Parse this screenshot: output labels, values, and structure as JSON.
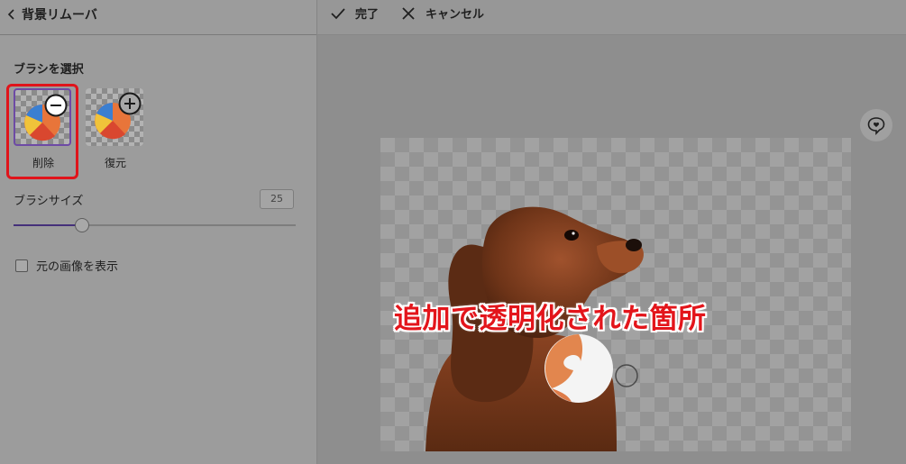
{
  "sidebar": {
    "title": "背景リムーバ",
    "brush_select_label": "ブラシを選択",
    "brushes": [
      {
        "label": "削除",
        "selected": true,
        "icon": "minus-circle-icon"
      },
      {
        "label": "復元",
        "selected": false,
        "icon": "plus-circle-icon"
      }
    ],
    "brush_size_label": "ブラシサイズ",
    "brush_size_value": "25",
    "brush_size_fraction": 0.24,
    "show_original_label": "元の画像を表示",
    "show_original_checked": false
  },
  "toolbar": {
    "done_label": "完了",
    "cancel_label": "キャンセル"
  },
  "canvas": {
    "annotation": "追加で透明化された箇所"
  },
  "colors": {
    "accent": "#6d4aa5",
    "highlight": "#e0141b",
    "annotation_text": "#e3151b"
  }
}
